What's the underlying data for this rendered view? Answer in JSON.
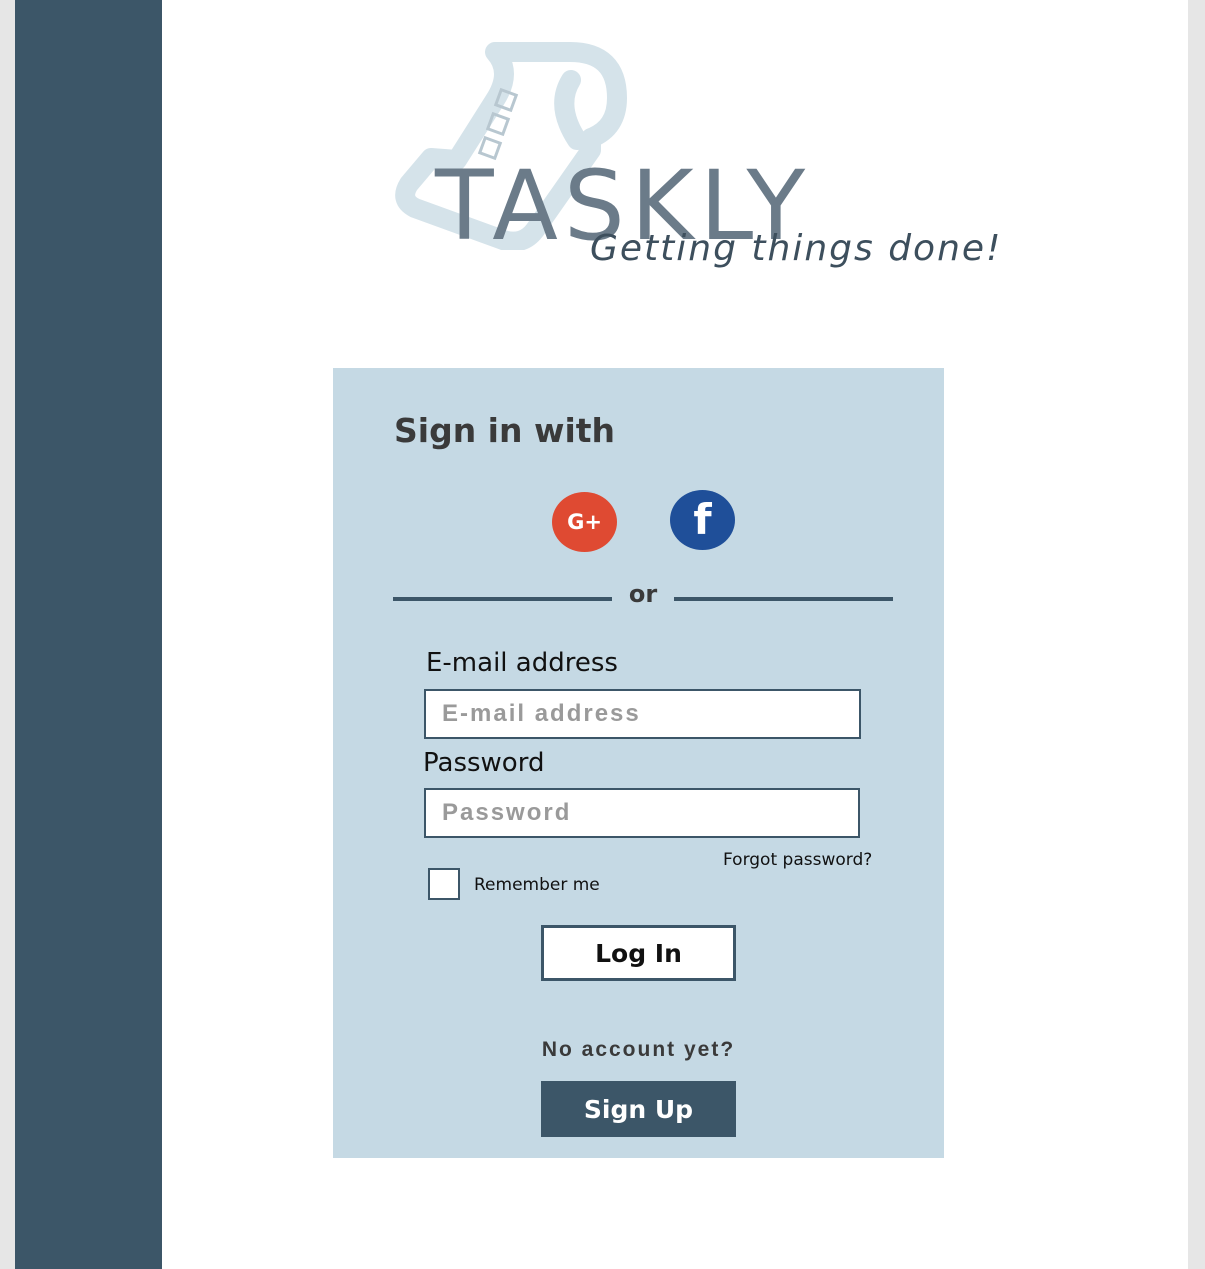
{
  "logo": {
    "wordmark": "TASKLY",
    "tagline": "Getting things done!"
  },
  "signin": {
    "heading": "Sign in with",
    "social": [
      {
        "name": "google-plus-icon",
        "glyph": "G+",
        "color": "#df4a32"
      },
      {
        "name": "facebook-icon",
        "glyph": "f",
        "color": "#1f4f99"
      }
    ],
    "divider_text": "or"
  },
  "form": {
    "email_label": "E-mail address",
    "email_placeholder": "E-mail address",
    "password_label": "Password",
    "password_placeholder": "Password",
    "forgot_link": "Forgot password?",
    "remember_label": "Remember me",
    "login_button": "Log In"
  },
  "signup": {
    "prompt": "No account yet?",
    "button": "Sign Up"
  },
  "colors": {
    "sidebar": "#3c5668",
    "card_bg": "#c5d9e4",
    "page_bg": "#ffffff",
    "frame": "#e6e6e6"
  }
}
